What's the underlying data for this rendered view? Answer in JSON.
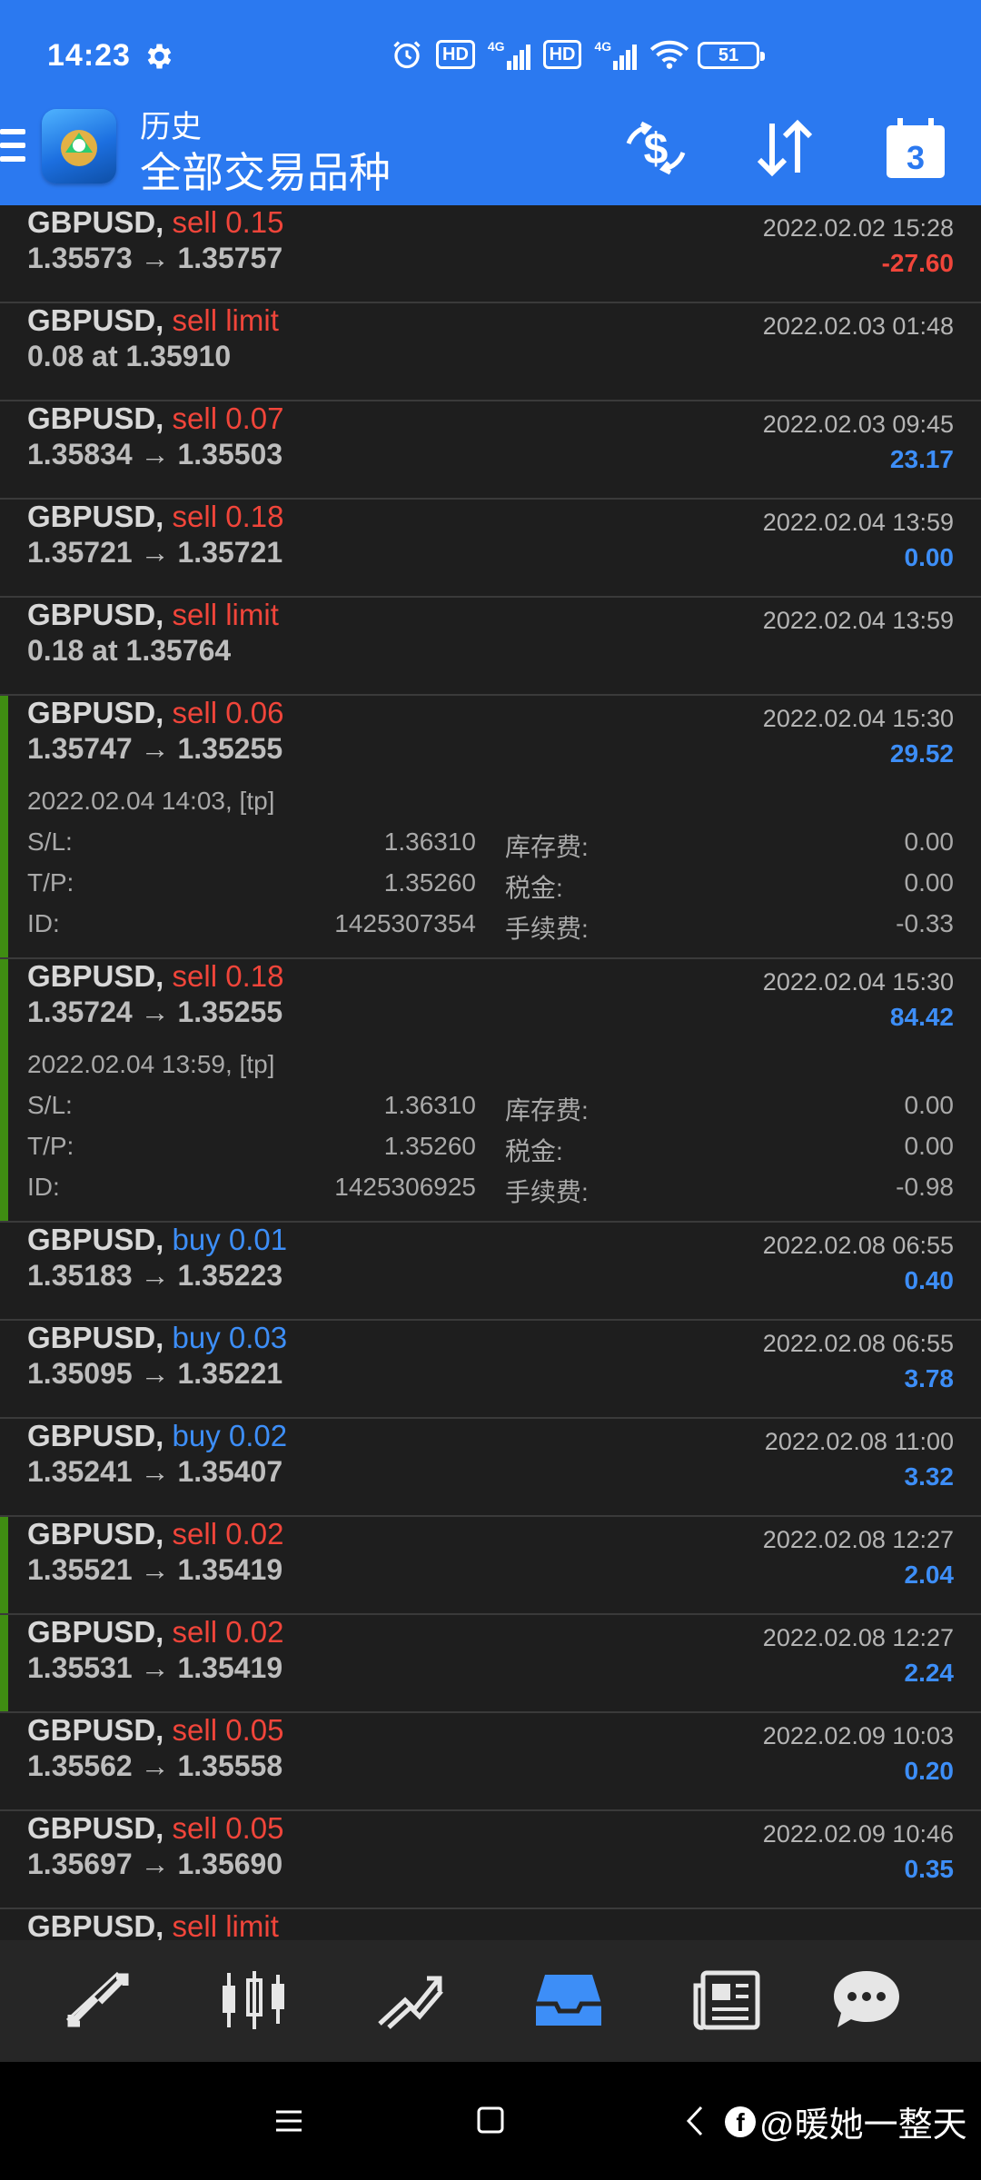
{
  "status_bar": {
    "time": "14:23",
    "icons": [
      "gear-icon",
      "alarm-icon",
      "hd-icon",
      "signal-icon",
      "hd-icon",
      "signal-icon",
      "wifi-icon"
    ],
    "hd1": "HD",
    "net1": "4G",
    "hd2": "HD",
    "net2": "4G",
    "battery": "51"
  },
  "header": {
    "subtitle": "历史",
    "title": "全部交易品种",
    "buttons": [
      "currency-exchange-icon",
      "sort-icon",
      "calendar-icon"
    ],
    "calendar_day": "3",
    "colors": {
      "bar": "#2b79f0"
    }
  },
  "colors": {
    "sell": "#f0453a",
    "buy": "#3d8ef7",
    "marker": "#3f8d12",
    "background": "#1e1e1e"
  },
  "trades": [
    {
      "symbol": "GBPUSD,",
      "action": "sell 0.15",
      "side": "sell",
      "prices": "1.35573 → 1.35757",
      "time": "2022.02.02 15:28",
      "profit": "-27.60"
    },
    {
      "symbol": "GBPUSD,",
      "action": "sell limit",
      "side": "sell",
      "prices": "0.08 at 1.35910",
      "time": "2022.02.03 01:48",
      "profit": ""
    },
    {
      "symbol": "GBPUSD,",
      "action": "sell 0.07",
      "side": "sell",
      "prices": "1.35834 → 1.35503",
      "time": "2022.02.03 09:45",
      "profit": "23.17"
    },
    {
      "symbol": "GBPUSD,",
      "action": "sell 0.18",
      "side": "sell",
      "prices": "1.35721 → 1.35721",
      "time": "2022.02.04 13:59",
      "profit": "0.00"
    },
    {
      "symbol": "GBPUSD,",
      "action": "sell limit",
      "side": "sell",
      "prices": "0.18 at 1.35764",
      "time": "2022.02.04 13:59",
      "profit": ""
    },
    {
      "symbol": "GBPUSD,",
      "action": "sell 0.06",
      "side": "sell",
      "prices": "1.35747 → 1.35255",
      "time": "2022.02.04 15:30",
      "profit": "29.52",
      "details": {
        "open": "2022.02.04 14:03, [tp]",
        "sl_label": "S/L:",
        "sl": "1.36310",
        "tp_label": "T/P:",
        "tp": "1.35260",
        "id_label": "ID:",
        "id": "1425307354",
        "swap_label": "库存费:",
        "swap": "0.00",
        "tax_label": "税金:",
        "tax": "0.00",
        "fee_label": "手续费:",
        "fee": "-0.33"
      }
    },
    {
      "symbol": "GBPUSD,",
      "action": "sell 0.18",
      "side": "sell",
      "prices": "1.35724 → 1.35255",
      "time": "2022.02.04 15:30",
      "profit": "84.42",
      "details": {
        "open": "2022.02.04 13:59, [tp]",
        "sl_label": "S/L:",
        "sl": "1.36310",
        "tp_label": "T/P:",
        "tp": "1.35260",
        "id_label": "ID:",
        "id": "1425306925",
        "swap_label": "库存费:",
        "swap": "0.00",
        "tax_label": "税金:",
        "tax": "0.00",
        "fee_label": "手续费:",
        "fee": "-0.98"
      }
    },
    {
      "symbol": "GBPUSD,",
      "action": "buy 0.01",
      "side": "buy",
      "prices": "1.35183 → 1.35223",
      "time": "2022.02.08 06:55",
      "profit": "0.40"
    },
    {
      "symbol": "GBPUSD,",
      "action": "buy 0.03",
      "side": "buy",
      "prices": "1.35095 → 1.35221",
      "time": "2022.02.08 06:55",
      "profit": "3.78"
    },
    {
      "symbol": "GBPUSD,",
      "action": "buy 0.02",
      "side": "buy",
      "prices": "1.35241 → 1.35407",
      "time": "2022.02.08 11:00",
      "profit": "3.32"
    },
    {
      "symbol": "GBPUSD,",
      "action": "sell 0.02",
      "side": "sell",
      "prices": "1.35521 → 1.35419",
      "time": "2022.02.08 12:27",
      "profit": "2.04"
    },
    {
      "symbol": "GBPUSD,",
      "action": "sell 0.02",
      "side": "sell",
      "prices": "1.35531 → 1.35419",
      "time": "2022.02.08 12:27",
      "profit": "2.24"
    },
    {
      "symbol": "GBPUSD,",
      "action": "sell 0.05",
      "side": "sell",
      "prices": "1.35562 → 1.35558",
      "time": "2022.02.09 10:03",
      "profit": "0.20"
    },
    {
      "symbol": "GBPUSD,",
      "action": "sell 0.05",
      "side": "sell",
      "prices": "1.35697 → 1.35690",
      "time": "2022.02.09 10:46",
      "profit": "0.35"
    }
  ],
  "partial_row": {
    "symbol": "GBPUSD,",
    "action": "sell limit"
  },
  "bottom_nav": {
    "items": [
      "quotes-icon",
      "chart-icon",
      "trade-icon",
      "history-icon",
      "news-icon",
      "chat-icon"
    ],
    "active": "history-icon"
  },
  "system_nav": {
    "buttons": [
      "recents-icon",
      "home-icon",
      "back-icon"
    ],
    "watermark": "@暖她一整天"
  }
}
